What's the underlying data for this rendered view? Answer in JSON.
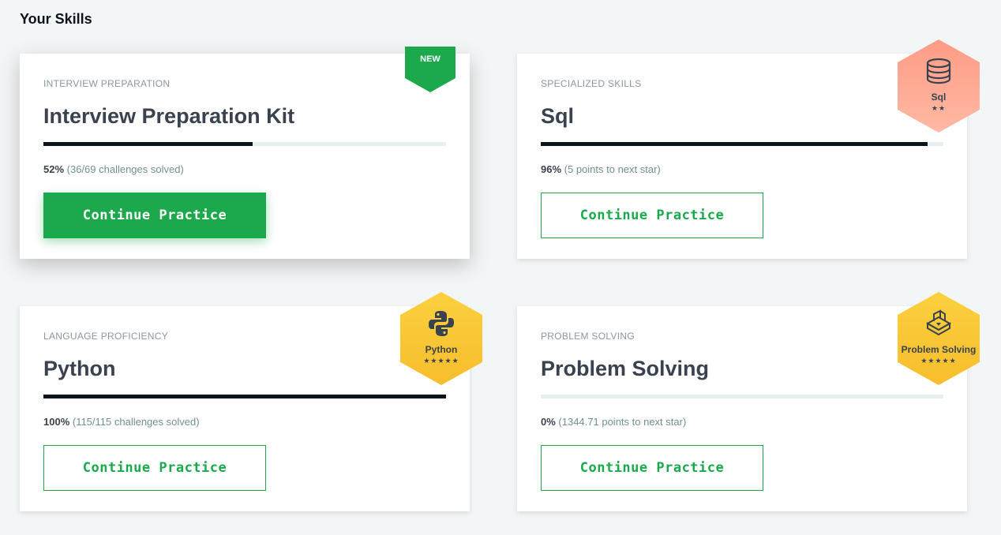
{
  "section_title": "Your Skills",
  "cards": [
    {
      "category": "INTERVIEW PREPARATION",
      "name": "Interview Preparation Kit",
      "progress_percent": 52,
      "percent_label": "52%",
      "detail": " (36/69 challenges solved)",
      "button_label": "Continue Practice",
      "ribbon": "NEW"
    },
    {
      "category": "SPECIALIZED SKILLS",
      "name": "Sql",
      "progress_percent": 96,
      "percent_label": "96%",
      "detail": " (5 points to next star)",
      "button_label": "Continue Practice",
      "badge": {
        "label": "Sql",
        "stars": "★★",
        "star_count": 2,
        "icon": "database-icon",
        "color": "#ffa78f"
      }
    },
    {
      "category": "LANGUAGE PROFICIENCY",
      "name": "Python",
      "progress_percent": 100,
      "percent_label": "100%",
      "detail": " (115/115 challenges solved)",
      "button_label": "Continue Practice",
      "badge": {
        "label": "Python",
        "stars": "★★★★★",
        "star_count": 5,
        "icon": "python-icon",
        "color": "#fdc93f"
      }
    },
    {
      "category": "PROBLEM SOLVING",
      "name": "Problem Solving",
      "progress_percent": 0,
      "percent_label": "0%",
      "detail": " (1344.71 points to next star)",
      "button_label": "Continue Practice",
      "badge": {
        "label": "Problem Solving",
        "stars": "★★★★★",
        "star_count": 5,
        "icon": "puzzle-icon",
        "color": "#fdc93f"
      }
    }
  ],
  "colors": {
    "accent_green": "#1ba94c",
    "progress_fill": "#0e141e",
    "progress_track": "#e7eef0",
    "badge_gold": "#fdc93f",
    "badge_salmon": "#ffa78f"
  }
}
